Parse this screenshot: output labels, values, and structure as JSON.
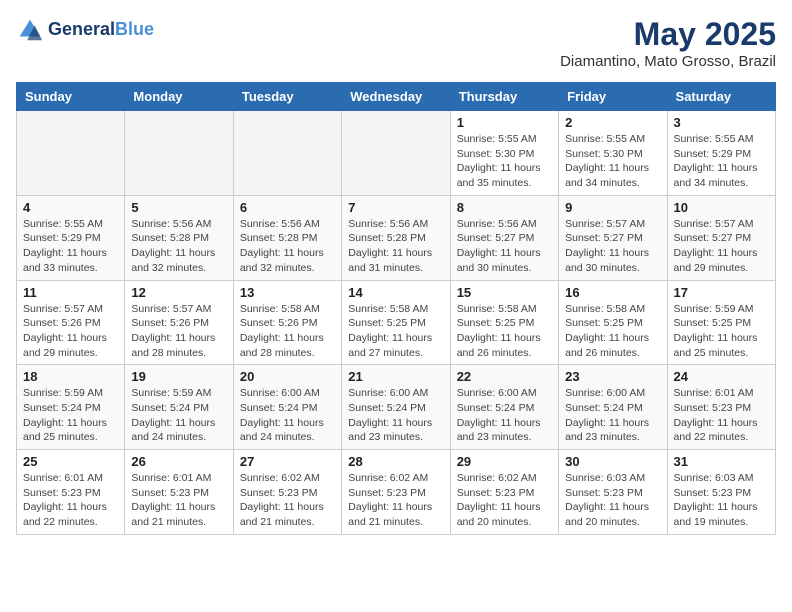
{
  "header": {
    "logo_line1": "General",
    "logo_line2": "Blue",
    "month": "May 2025",
    "location": "Diamantino, Mato Grosso, Brazil"
  },
  "weekdays": [
    "Sunday",
    "Monday",
    "Tuesday",
    "Wednesday",
    "Thursday",
    "Friday",
    "Saturday"
  ],
  "weeks": [
    [
      {
        "day": "",
        "empty": true
      },
      {
        "day": "",
        "empty": true
      },
      {
        "day": "",
        "empty": true
      },
      {
        "day": "",
        "empty": true
      },
      {
        "day": "1",
        "sunrise": "Sunrise: 5:55 AM",
        "sunset": "Sunset: 5:30 PM",
        "daylight": "Daylight: 11 hours and 35 minutes."
      },
      {
        "day": "2",
        "sunrise": "Sunrise: 5:55 AM",
        "sunset": "Sunset: 5:30 PM",
        "daylight": "Daylight: 11 hours and 34 minutes."
      },
      {
        "day": "3",
        "sunrise": "Sunrise: 5:55 AM",
        "sunset": "Sunset: 5:29 PM",
        "daylight": "Daylight: 11 hours and 34 minutes."
      }
    ],
    [
      {
        "day": "4",
        "sunrise": "Sunrise: 5:55 AM",
        "sunset": "Sunset: 5:29 PM",
        "daylight": "Daylight: 11 hours and 33 minutes."
      },
      {
        "day": "5",
        "sunrise": "Sunrise: 5:56 AM",
        "sunset": "Sunset: 5:28 PM",
        "daylight": "Daylight: 11 hours and 32 minutes."
      },
      {
        "day": "6",
        "sunrise": "Sunrise: 5:56 AM",
        "sunset": "Sunset: 5:28 PM",
        "daylight": "Daylight: 11 hours and 32 minutes."
      },
      {
        "day": "7",
        "sunrise": "Sunrise: 5:56 AM",
        "sunset": "Sunset: 5:28 PM",
        "daylight": "Daylight: 11 hours and 31 minutes."
      },
      {
        "day": "8",
        "sunrise": "Sunrise: 5:56 AM",
        "sunset": "Sunset: 5:27 PM",
        "daylight": "Daylight: 11 hours and 30 minutes."
      },
      {
        "day": "9",
        "sunrise": "Sunrise: 5:57 AM",
        "sunset": "Sunset: 5:27 PM",
        "daylight": "Daylight: 11 hours and 30 minutes."
      },
      {
        "day": "10",
        "sunrise": "Sunrise: 5:57 AM",
        "sunset": "Sunset: 5:27 PM",
        "daylight": "Daylight: 11 hours and 29 minutes."
      }
    ],
    [
      {
        "day": "11",
        "sunrise": "Sunrise: 5:57 AM",
        "sunset": "Sunset: 5:26 PM",
        "daylight": "Daylight: 11 hours and 29 minutes."
      },
      {
        "day": "12",
        "sunrise": "Sunrise: 5:57 AM",
        "sunset": "Sunset: 5:26 PM",
        "daylight": "Daylight: 11 hours and 28 minutes."
      },
      {
        "day": "13",
        "sunrise": "Sunrise: 5:58 AM",
        "sunset": "Sunset: 5:26 PM",
        "daylight": "Daylight: 11 hours and 28 minutes."
      },
      {
        "day": "14",
        "sunrise": "Sunrise: 5:58 AM",
        "sunset": "Sunset: 5:25 PM",
        "daylight": "Daylight: 11 hours and 27 minutes."
      },
      {
        "day": "15",
        "sunrise": "Sunrise: 5:58 AM",
        "sunset": "Sunset: 5:25 PM",
        "daylight": "Daylight: 11 hours and 26 minutes."
      },
      {
        "day": "16",
        "sunrise": "Sunrise: 5:58 AM",
        "sunset": "Sunset: 5:25 PM",
        "daylight": "Daylight: 11 hours and 26 minutes."
      },
      {
        "day": "17",
        "sunrise": "Sunrise: 5:59 AM",
        "sunset": "Sunset: 5:25 PM",
        "daylight": "Daylight: 11 hours and 25 minutes."
      }
    ],
    [
      {
        "day": "18",
        "sunrise": "Sunrise: 5:59 AM",
        "sunset": "Sunset: 5:24 PM",
        "daylight": "Daylight: 11 hours and 25 minutes."
      },
      {
        "day": "19",
        "sunrise": "Sunrise: 5:59 AM",
        "sunset": "Sunset: 5:24 PM",
        "daylight": "Daylight: 11 hours and 24 minutes."
      },
      {
        "day": "20",
        "sunrise": "Sunrise: 6:00 AM",
        "sunset": "Sunset: 5:24 PM",
        "daylight": "Daylight: 11 hours and 24 minutes."
      },
      {
        "day": "21",
        "sunrise": "Sunrise: 6:00 AM",
        "sunset": "Sunset: 5:24 PM",
        "daylight": "Daylight: 11 hours and 23 minutes."
      },
      {
        "day": "22",
        "sunrise": "Sunrise: 6:00 AM",
        "sunset": "Sunset: 5:24 PM",
        "daylight": "Daylight: 11 hours and 23 minutes."
      },
      {
        "day": "23",
        "sunrise": "Sunrise: 6:00 AM",
        "sunset": "Sunset: 5:24 PM",
        "daylight": "Daylight: 11 hours and 23 minutes."
      },
      {
        "day": "24",
        "sunrise": "Sunrise: 6:01 AM",
        "sunset": "Sunset: 5:23 PM",
        "daylight": "Daylight: 11 hours and 22 minutes."
      }
    ],
    [
      {
        "day": "25",
        "sunrise": "Sunrise: 6:01 AM",
        "sunset": "Sunset: 5:23 PM",
        "daylight": "Daylight: 11 hours and 22 minutes."
      },
      {
        "day": "26",
        "sunrise": "Sunrise: 6:01 AM",
        "sunset": "Sunset: 5:23 PM",
        "daylight": "Daylight: 11 hours and 21 minutes."
      },
      {
        "day": "27",
        "sunrise": "Sunrise: 6:02 AM",
        "sunset": "Sunset: 5:23 PM",
        "daylight": "Daylight: 11 hours and 21 minutes."
      },
      {
        "day": "28",
        "sunrise": "Sunrise: 6:02 AM",
        "sunset": "Sunset: 5:23 PM",
        "daylight": "Daylight: 11 hours and 21 minutes."
      },
      {
        "day": "29",
        "sunrise": "Sunrise: 6:02 AM",
        "sunset": "Sunset: 5:23 PM",
        "daylight": "Daylight: 11 hours and 20 minutes."
      },
      {
        "day": "30",
        "sunrise": "Sunrise: 6:03 AM",
        "sunset": "Sunset: 5:23 PM",
        "daylight": "Daylight: 11 hours and 20 minutes."
      },
      {
        "day": "31",
        "sunrise": "Sunrise: 6:03 AM",
        "sunset": "Sunset: 5:23 PM",
        "daylight": "Daylight: 11 hours and 19 minutes."
      }
    ]
  ]
}
